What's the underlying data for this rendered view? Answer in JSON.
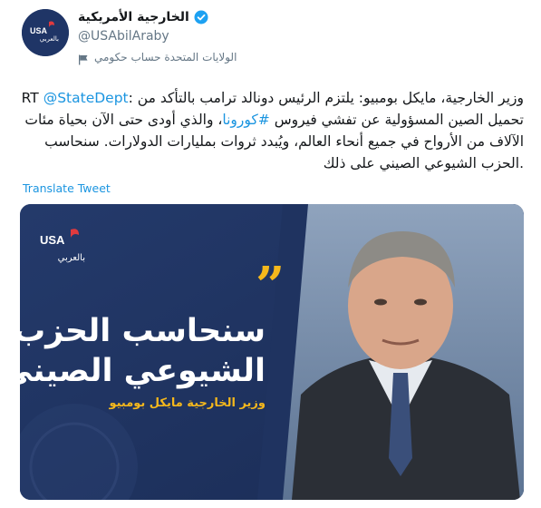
{
  "account": {
    "display_name": "الخارجية الأمريكية",
    "handle": "@USAbilAraby",
    "label": "الولايات المتحدة حساب حكومي",
    "avatar_text_top": "USA",
    "avatar_text_bottom": "بالعربي"
  },
  "tweet": {
    "rt_prefix": "RT",
    "mention": "@StateDept",
    "text_part1": ": وزير الخارجية، مايكل بومبيو: يلتزم الرئيس دونالد ترامب بالتأكد من تحميل الصين المسؤولية عن تفشي فيروس ",
    "hashtag": "#كورونا",
    "text_part2": "، والذي أودى حتى الآن بحياة مئات الآلاف من الأرواح في جميع أنحاء العالم، ويُبدد ثروات بمليارات الدولارات. سنحاسب الحزب الشيوعي الصيني على ذلك.",
    "translate_label": "Translate Tweet"
  },
  "media": {
    "logo_top": "USA",
    "logo_bottom": "بالعربي",
    "quote_line1": "سنحاسب الحزب",
    "quote_line2": "الشيوعي الصيني",
    "speaker": "وزير الخارجية مايكل بومبيو",
    "quote_mark": "”"
  },
  "colors": {
    "link": "#1b95e0",
    "media_bg": "#1f3360",
    "accent_gold": "#f5b81c",
    "avatar_bg": "#1f3566"
  },
  "icons": {
    "verified": "verified-badge-icon",
    "government": "flag-icon"
  }
}
